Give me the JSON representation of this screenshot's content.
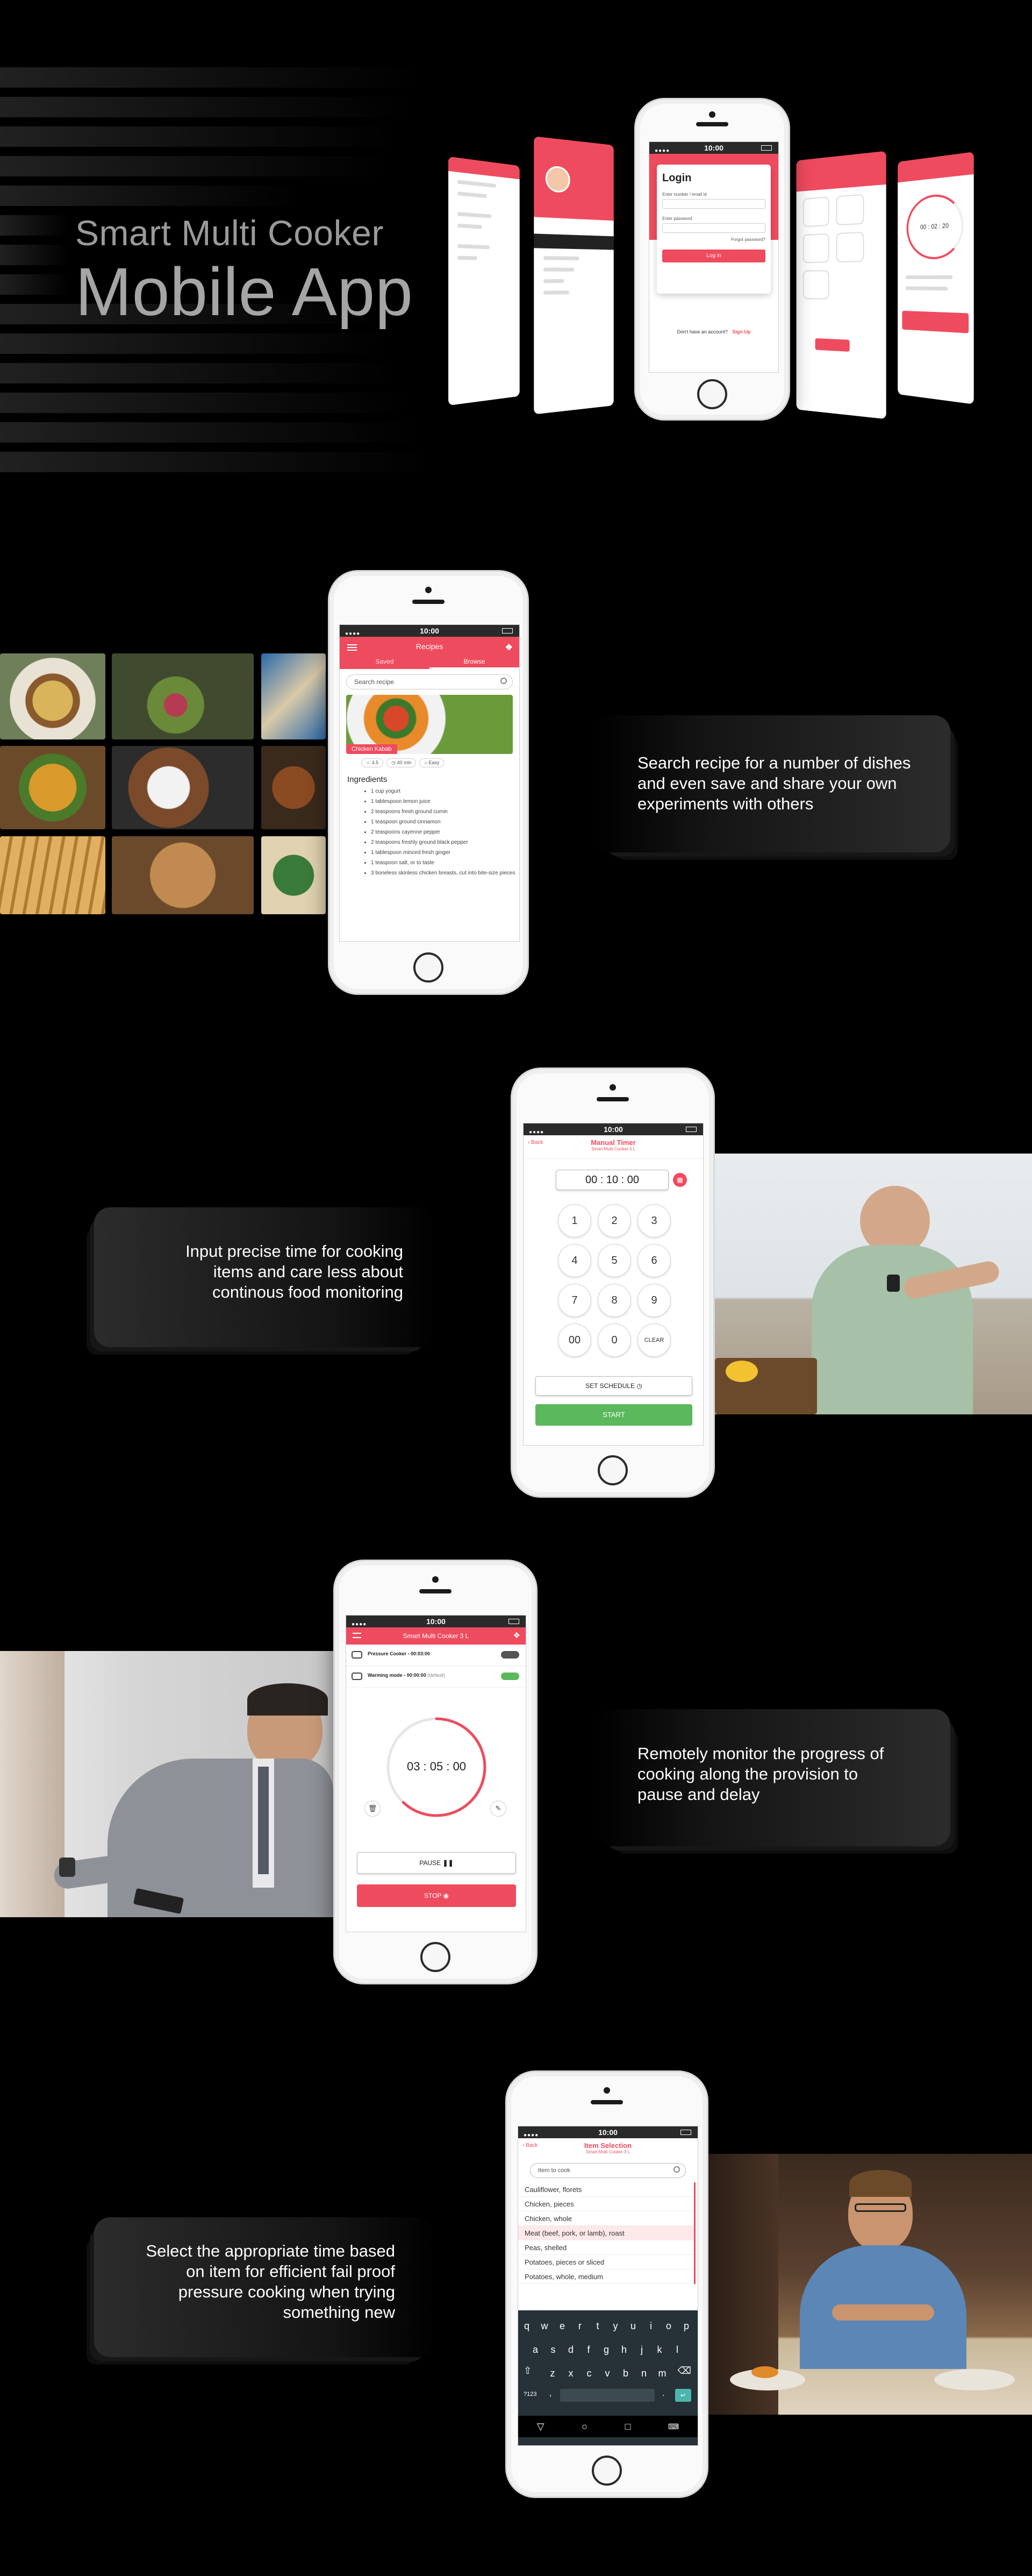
{
  "hero": {
    "subtitle": "Smart Multi Cooker",
    "title": "Mobile App",
    "login_screen": {
      "time": "10:00",
      "heading": "Login",
      "email_label": "Enter number / email id",
      "password_label": "Enter password",
      "forgot": "Forgot password?",
      "login_button": "Log in",
      "signup_prompt": "Don't have an account?",
      "signup_link": "Sign Up"
    },
    "timer_panel": {
      "time": "00 : 02 : 20"
    }
  },
  "recipes": {
    "time": "10:00",
    "header_title": "Recipes",
    "tabs": [
      "Saved",
      "Browse"
    ],
    "search_placeholder": "Search recipe",
    "dish_name": "Chicken Kabab",
    "meta": [
      "4.5",
      "40 min",
      "Easy"
    ],
    "ingredients_heading": "Ingredients",
    "ingredients": [
      "1 cup yogurt",
      "1 tablespoon lemon juice",
      "2 teaspoons fresh ground cumin",
      "1 teaspoon ground cinnamon",
      "2 teaspoons cayenne pepper",
      "2 teaspoons freshly ground black pepper",
      "1 tablespoon minced fresh ginger",
      "1 teaspoon salt, or to taste",
      "3 boneless skinless chicken breasts, cut into bite-size pieces"
    ],
    "caption": "Search recipe for a number of dishes and even save and share your own experiments with others"
  },
  "manual_timer": {
    "time": "10:00",
    "back": "Back",
    "title": "Manual Timer",
    "subtitle": "Smart Multi Cooker 3 L",
    "display": "00 : 10 : 00",
    "keys": [
      "1",
      "2",
      "3",
      "4",
      "5",
      "6",
      "7",
      "8",
      "9",
      "00",
      "0",
      "CLEAR"
    ],
    "schedule_button": "SET SCHEDULE",
    "start_button": "START",
    "caption": "Input precise time for cooking items and care less about continous food monitoring"
  },
  "monitor": {
    "time": "10:00",
    "header_title": "Smart Multi Cooker 3 L",
    "row1_label": "Pressure Cooker - 00:03:00",
    "row2_label": "Warming mode - 00:00:00",
    "row2_note": "(default)",
    "countdown": "03 : 05 : 00",
    "progress_fraction": 0.62,
    "pause_button": "PAUSE",
    "stop_button": "STOP",
    "caption": "Remotely monitor the progress of cooking along the provision to pause and delay"
  },
  "item_selection": {
    "time": "10:00",
    "back": "Back",
    "title": "Item Selection",
    "subtitle": "Smart Multi Cooker 3 L",
    "search_placeholder": "Item to cook",
    "items": [
      "Cauliflower, florets",
      "Chicken, pieces",
      "Chicken, whole",
      "Meat (beef, pork, or lamb), roast",
      "Peas, shelled",
      "Potatoes, pieces or sliced",
      "Potatoes, whole, medium"
    ],
    "keyboard_row1": [
      "q",
      "w",
      "e",
      "r",
      "t",
      "y",
      "u",
      "i",
      "o",
      "p"
    ],
    "keyboard_row2": [
      "a",
      "s",
      "d",
      "f",
      "g",
      "h",
      "j",
      "k",
      "l"
    ],
    "keyboard_row3": [
      "z",
      "x",
      "c",
      "v",
      "b",
      "n",
      "m"
    ],
    "keyboard_sym": "?123",
    "caption": "Select the appropriate time based on item for efficient fail proof pressure cooking when trying something new"
  },
  "colors": {
    "accent": "#ef4b5e",
    "start_green": "#5cb85c",
    "background": "#000000"
  }
}
